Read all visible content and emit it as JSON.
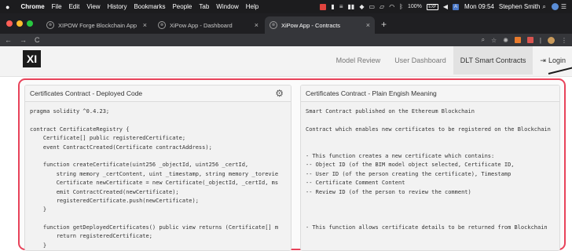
{
  "menubar": {
    "apple": "",
    "app": "Chrome",
    "items": [
      "File",
      "Edit",
      "View",
      "History",
      "Bookmarks",
      "People",
      "Tab",
      "Window",
      "Help"
    ],
    "battery_pct": "100%",
    "battery_label": "EXP",
    "status_square": "A",
    "clock": "Mon 09:54",
    "user": "Stephen Smith"
  },
  "tabs": [
    {
      "label": "XIPOW Forge Blockchain App",
      "active": false
    },
    {
      "label": "XiPow App - Dashboard",
      "active": false
    },
    {
      "label": "XiPow App - Contracts",
      "active": true
    }
  ],
  "new_tab": "+",
  "nav": {
    "back": "←",
    "forward": "→",
    "reload": "C"
  },
  "app": {
    "logo": "XI",
    "nav_links": [
      "Model Review",
      "User Dashboard",
      "DLT Smart Contracts"
    ],
    "active_link": "DLT Smart Contracts",
    "login": "Login"
  },
  "left_panel": {
    "title": "Certificates Contract - Deployed Code",
    "lines": [
      "pragma solidity ^0.4.23;",
      "",
      "contract CertificateRegistry {",
      "    Certificate[] public registeredCertificate;",
      "    event ContractCreated(Certificate contractAddress);",
      "",
      "    function createCertificate(uint256 _objectId, uint256 _certId,",
      "        string memory _certContent, uint _timestamp, string memory _torevie",
      "        Certificate newCertificate = new Certificate(_objectId, _certId, ms",
      "        emit ContractCreated(newCertificate);",
      "        registeredCertificate.push(newCertificate);",
      "    }",
      "",
      "    function getDeployedCertificates() public view returns (Certificate[] m",
      "        return registeredCertificate;",
      "    }",
      "}"
    ]
  },
  "right_panel": {
    "title": "Certificates Contract - Plain Engish Meaning",
    "lines": [
      "Smart Contract published on the Ethereum Blockchain",
      "",
      "Contract which enables new certificates to be registered on the Blockchain",
      "",
      "",
      "- This function creates a new certificate which contains:",
      "-- Object ID (of the BIM model object selected, Certificate ID,",
      "-- User ID (of the person creating the certificate), Timestamp",
      "-- Certificate Comment Content",
      "-- Review ID (of the person to review the comment)",
      "",
      "",
      "",
      "- This function allows certificate details to be returned from Blockchain",
      "",
      "",
      ""
    ]
  },
  "icons": {
    "settings": "gear-icon",
    "close": "close-icon"
  }
}
